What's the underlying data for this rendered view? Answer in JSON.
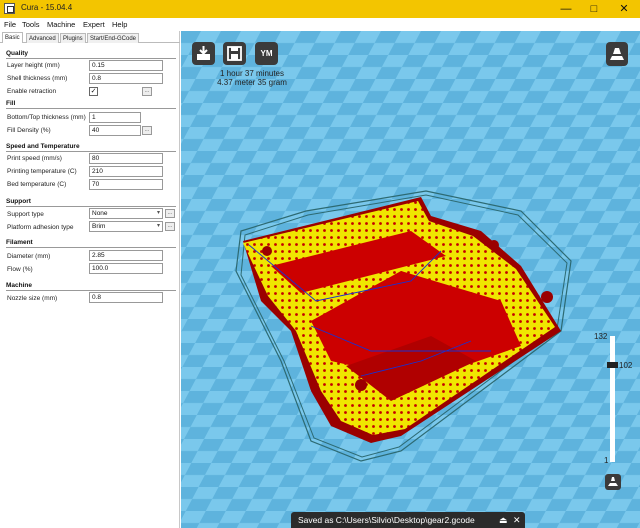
{
  "window": {
    "title": "Cura - 15.04.4",
    "minimize_glyph": "—",
    "maximize_glyph": "□",
    "close_glyph": "✕"
  },
  "menu": [
    "File",
    "Tools",
    "Machine",
    "Expert",
    "Help"
  ],
  "tabs": [
    "Basic",
    "Advanced",
    "Plugins",
    "Start/End-GCode"
  ],
  "sections": {
    "quality": "Quality",
    "fill": "Fill",
    "speed": "Speed and Temperature",
    "support": "Support",
    "filament": "Filament",
    "machine": "Machine"
  },
  "fields": {
    "layer_height": {
      "label": "Layer height (mm)",
      "value": "0.15"
    },
    "shell_thickness": {
      "label": "Shell thickness (mm)",
      "value": "0.8"
    },
    "enable_retraction": {
      "label": "Enable retraction",
      "value": "✓"
    },
    "bottom_top_thickness": {
      "label": "Bottom/Top thickness (mm)",
      "value": "1"
    },
    "fill_density": {
      "label": "Fill Density (%)",
      "value": "40"
    },
    "print_speed": {
      "label": "Print speed (mm/s)",
      "value": "80"
    },
    "printing_temperature": {
      "label": "Printing temperature (C)",
      "value": "210"
    },
    "bed_temperature": {
      "label": "Bed temperature (C)",
      "value": "70"
    },
    "support_type": {
      "label": "Support type",
      "value": "None"
    },
    "platform_adhesion": {
      "label": "Platform adhesion type",
      "value": "Brim"
    },
    "diameter": {
      "label": "Diameter (mm)",
      "value": "2.85"
    },
    "flow": {
      "label": "Flow (%)",
      "value": "100.0"
    },
    "nozzle_size": {
      "label": "Nozzle size (mm)",
      "value": "0.8"
    }
  },
  "more_button_label": "...",
  "viewport": {
    "ym_label": "YM",
    "print_time": "1 hour 37 minutes",
    "print_material": "4.37 meter 35 gram",
    "layer_max": "132",
    "layer_current": "102",
    "layer_min": "1"
  },
  "notification": {
    "text": "Saved as C:\\Users\\Silvio\\Desktop\\gear2.gcode",
    "eject_glyph": "⏏",
    "close_glyph": "✕"
  },
  "colors": {
    "titlebar": "#f3c500",
    "viewport_bg": "#7ac8ec",
    "checker_dark": "#5eb3dd",
    "model_red": "#cc0000",
    "model_yellow": "#f0e600"
  }
}
